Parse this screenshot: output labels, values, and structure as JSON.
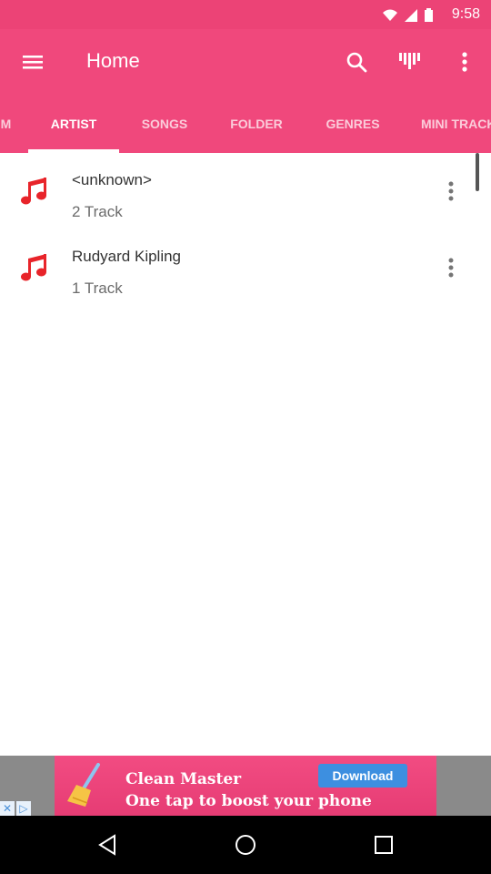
{
  "status_bar": {
    "time": "9:58"
  },
  "toolbar": {
    "title": "Home",
    "menu_icon": "menu-icon",
    "search_icon": "search-icon",
    "equalizer_icon": "equalizer-icon",
    "more_icon": "more-vert-icon"
  },
  "tabs": [
    {
      "label": "ALBUM",
      "active": false
    },
    {
      "label": "ARTIST",
      "active": true
    },
    {
      "label": "SONGS",
      "active": false
    },
    {
      "label": "FOLDER",
      "active": false
    },
    {
      "label": "GENRES",
      "active": false
    },
    {
      "label": "MINI TRACKS",
      "active": false
    }
  ],
  "artists": [
    {
      "name": "<unknown>",
      "count": "2 Track"
    },
    {
      "name": "Rudyard Kipling",
      "count": "1 Track"
    }
  ],
  "ad": {
    "line1": "Clean Master",
    "line2": "One tap to boost your phone",
    "button": "Download"
  },
  "colors": {
    "primary": "#f0487c",
    "accent": "#e8242a"
  }
}
